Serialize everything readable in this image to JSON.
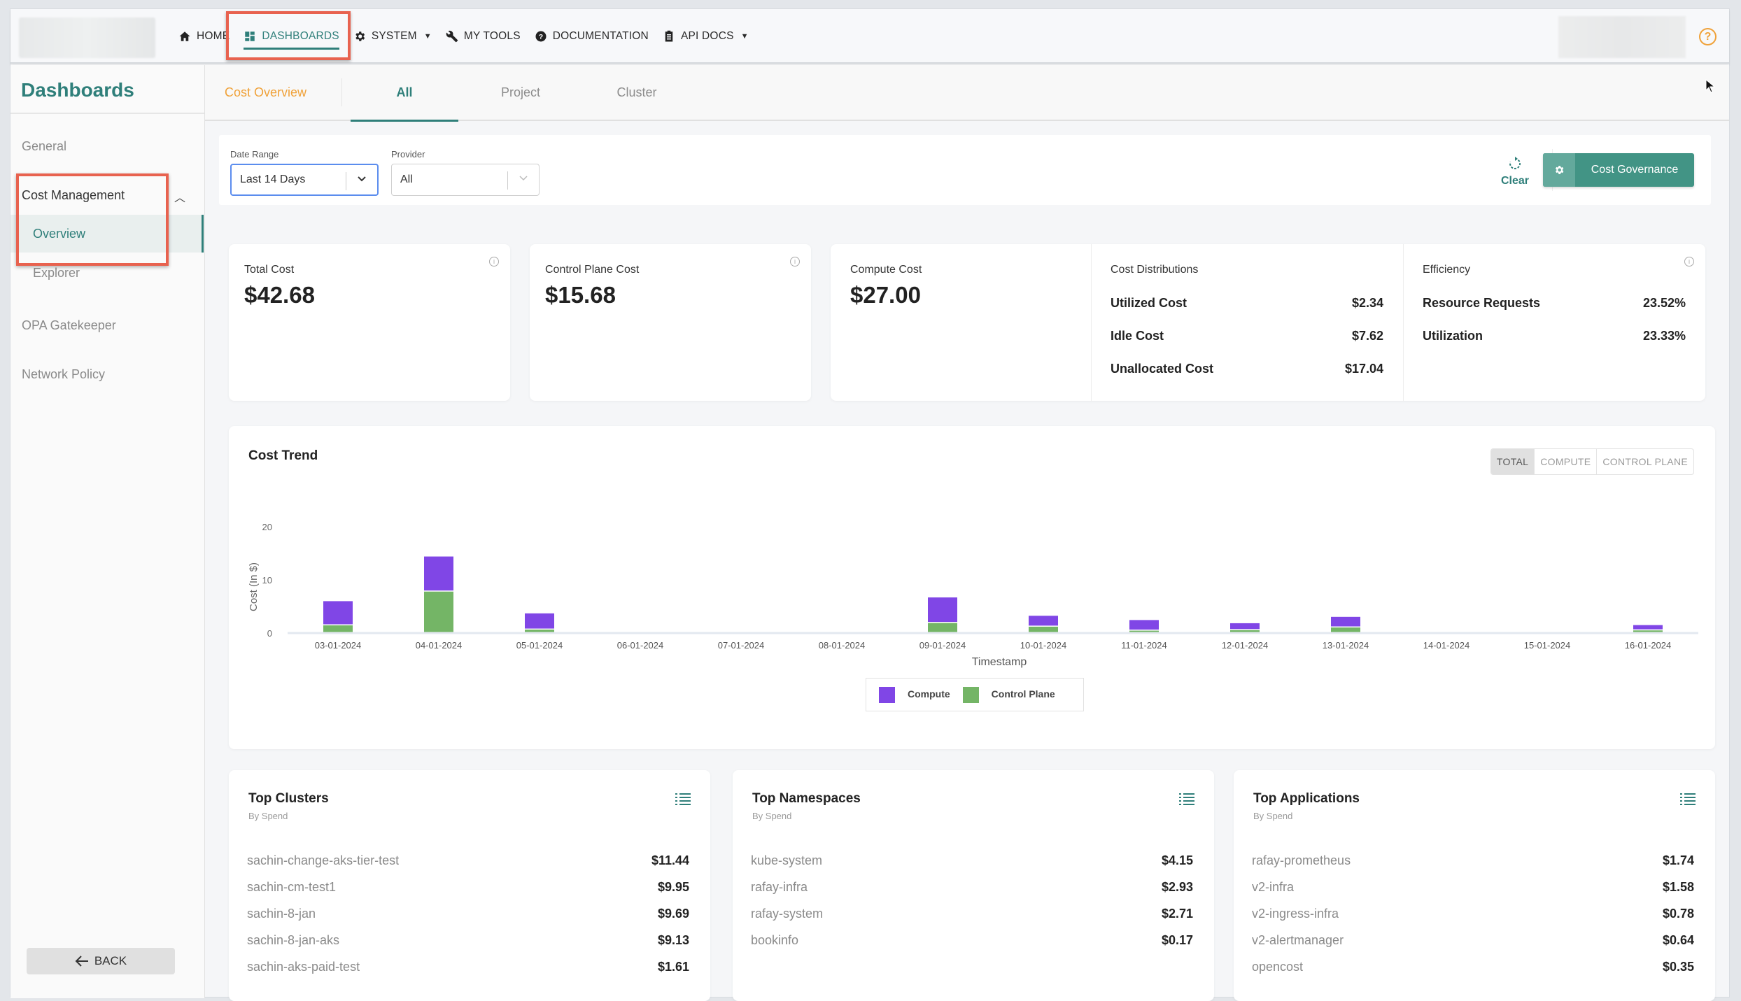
{
  "nav": {
    "items": [
      {
        "label": "HOME",
        "icon": "home-icon"
      },
      {
        "label": "DASHBOARDS",
        "icon": "dashboard-icon",
        "active": true
      },
      {
        "label": "SYSTEM",
        "icon": "gear-icon",
        "dropdown": true
      },
      {
        "label": "MY TOOLS",
        "icon": "wrench-icon"
      },
      {
        "label": "DOCUMENTATION",
        "icon": "help-circle-icon"
      },
      {
        "label": "API DOCS",
        "icon": "clipboard-icon",
        "dropdown": true
      }
    ],
    "help_icon": "?"
  },
  "sidebar": {
    "title": "Dashboards",
    "items": [
      {
        "label": "General"
      },
      {
        "label": "Cost Management",
        "expanded": true,
        "children": [
          {
            "label": "Overview",
            "active": true
          },
          {
            "label": "Explorer"
          }
        ]
      },
      {
        "label": "OPA Gatekeeper"
      },
      {
        "label": "Network Policy"
      }
    ],
    "back_label": "BACK"
  },
  "tabs": {
    "title": "Cost Overview",
    "items": [
      "All",
      "Project",
      "Cluster"
    ],
    "active": "All"
  },
  "filters": {
    "date_range": {
      "label": "Date Range",
      "value": "Last 14 Days"
    },
    "provider": {
      "label": "Provider",
      "value": "All"
    },
    "clear_label": "Clear",
    "governance_label": "Cost Governance"
  },
  "stats": {
    "total": {
      "label": "Total Cost",
      "value": "$42.68"
    },
    "control_plane": {
      "label": "Control Plane Cost",
      "value": "$15.68"
    },
    "compute": {
      "label": "Compute Cost",
      "value": "$27.00"
    },
    "distributions": {
      "title": "Cost Distributions",
      "rows": [
        {
          "label": "Utilized Cost",
          "value": "$2.34"
        },
        {
          "label": "Idle Cost",
          "value": "$7.62"
        },
        {
          "label": "Unallocated Cost",
          "value": "$17.04"
        }
      ]
    },
    "efficiency": {
      "title": "Efficiency",
      "rows": [
        {
          "label": "Resource Requests",
          "value": "23.52%"
        },
        {
          "label": "Utilization",
          "value": "23.33%"
        }
      ]
    }
  },
  "chart_toggle": {
    "options": [
      "TOTAL",
      "COMPUTE",
      "CONTROL PLANE"
    ],
    "active": "TOTAL"
  },
  "chart_data": {
    "type": "bar",
    "stacked": true,
    "title": "Cost Trend",
    "xlabel": "Timestamp",
    "ylabel": "Cost (In $)",
    "ylim": [
      0,
      20
    ],
    "yticks": [
      0,
      10,
      20
    ],
    "grid": false,
    "legend": "bottom-center",
    "categories": [
      "03-01-2024",
      "04-01-2024",
      "05-01-2024",
      "06-01-2024",
      "07-01-2024",
      "08-01-2024",
      "09-01-2024",
      "10-01-2024",
      "11-01-2024",
      "12-01-2024",
      "13-01-2024",
      "14-01-2024",
      "15-01-2024",
      "16-01-2024"
    ],
    "series": [
      {
        "name": "Control Plane",
        "color": "#74b566",
        "values": [
          1.45,
          7.8,
          0.65,
          0,
          0,
          0,
          1.9,
          1.2,
          0.45,
          0.55,
          1.05,
          0,
          0,
          0.5
        ]
      },
      {
        "name": "Compute",
        "color": "#8046e6",
        "values": [
          4.55,
          6.6,
          3.05,
          0,
          0,
          0,
          4.8,
          2.05,
          2.0,
          1.3,
          2.0,
          0,
          0,
          1.0
        ]
      }
    ],
    "legend_order": [
      "Compute",
      "Control Plane"
    ]
  },
  "lists": [
    {
      "title": "Top Clusters",
      "subtitle": "By Spend",
      "rows": [
        {
          "name": "sachin-change-aks-tier-test",
          "value": "$11.44"
        },
        {
          "name": "sachin-cm-test1",
          "value": "$9.95"
        },
        {
          "name": "sachin-8-jan",
          "value": "$9.69"
        },
        {
          "name": "sachin-8-jan-aks",
          "value": "$9.13"
        },
        {
          "name": "sachin-aks-paid-test",
          "value": "$1.61"
        }
      ]
    },
    {
      "title": "Top Namespaces",
      "subtitle": "By Spend",
      "rows": [
        {
          "name": "kube-system",
          "value": "$4.15"
        },
        {
          "name": "rafay-infra",
          "value": "$2.93"
        },
        {
          "name": "rafay-system",
          "value": "$2.71"
        },
        {
          "name": "bookinfo",
          "value": "$0.17"
        }
      ]
    },
    {
      "title": "Top Applications",
      "subtitle": "By Spend",
      "rows": [
        {
          "name": "rafay-prometheus",
          "value": "$1.74"
        },
        {
          "name": "v2-infra",
          "value": "$1.58"
        },
        {
          "name": "v2-ingress-infra",
          "value": "$0.78"
        },
        {
          "name": "v2-alertmanager",
          "value": "$0.64"
        },
        {
          "name": "opencost",
          "value": "$0.35"
        }
      ]
    }
  ],
  "colors": {
    "accent": "#2f7f7a",
    "orange": "#f0a23a",
    "highlight": "#e8624f",
    "button": "#429485"
  }
}
